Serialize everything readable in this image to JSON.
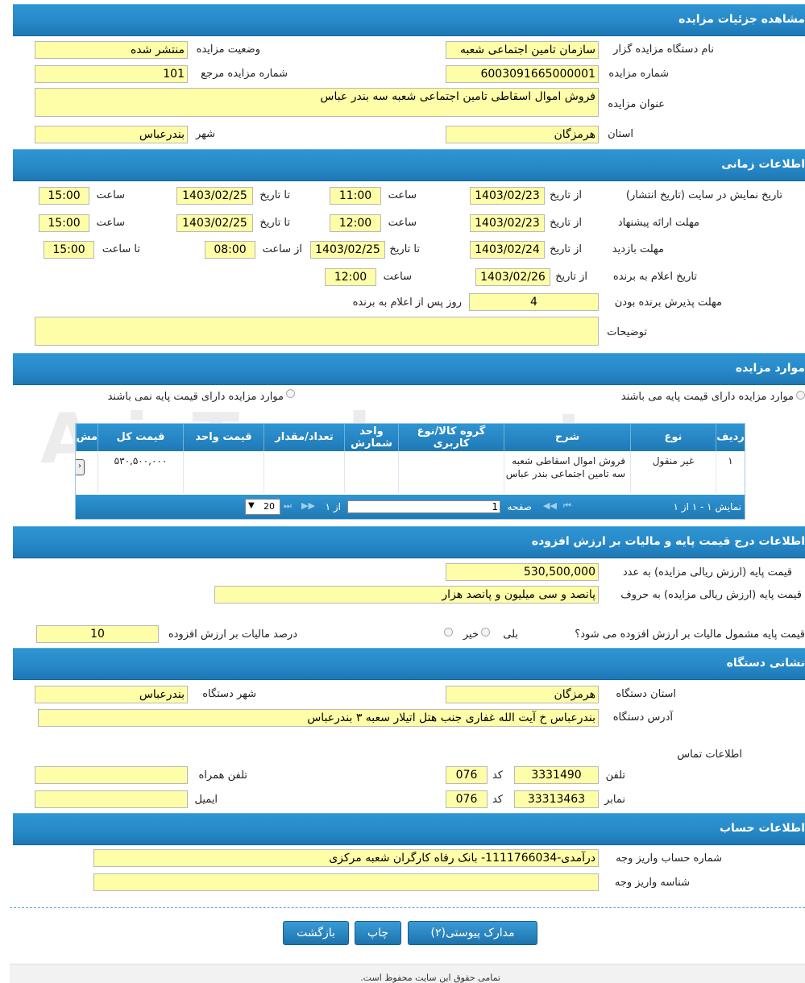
{
  "sections": {
    "details": "مشاهده جزئیات مزایده",
    "timing": "اطلاعات زمانی",
    "items": "موارد مزایده",
    "price": "اطلاعات درج قیمت پایه و مالیات بر ارزش افزوده",
    "address": "نشانی دستگاه",
    "account": "اطلاعات حساب"
  },
  "details": {
    "org_label": "نام دستگاه مزایده گزار",
    "org_value": "سازمان تامین اجتماعی شعبه",
    "status_label": "وضعیت مزایده",
    "status_value": "منتشر شده",
    "number_label": "شماره مزایده",
    "number_value": "6003091665000001",
    "ref_label": "شماره مزایده مرجع",
    "ref_value": "101",
    "title_label": "عنوان مزایده",
    "title_value": "فروش اموال اسقاطی تامین اجتماعی شعبه سه بندر عباس",
    "province_label": "استان",
    "province_value": "هرمزگان",
    "city_label": "شهر",
    "city_value": "بندرعباس"
  },
  "timing": {
    "from_date": "از تاریخ",
    "to_date": "تا تاریخ",
    "hour": "ساعت",
    "to_hour": "تا ساعت",
    "from_hour": "از ساعت",
    "display_label": "تاریخ نمایش در سایت (تاریخ انتشار)",
    "display_from": "1403/02/23",
    "display_from_time": "11:00",
    "display_to": "1403/02/25",
    "display_to_time": "15:00",
    "offer_label": "مهلت ارائه پیشنهاد",
    "offer_from": "1403/02/23",
    "offer_from_time": "12:00",
    "offer_to": "1403/02/25",
    "offer_to_time": "15:00",
    "visit_label": "مهلت بازدید",
    "visit_from": "1403/02/24",
    "visit_to": "1403/02/25",
    "visit_from_time": "08:00",
    "visit_to_time": "15:00",
    "winner_label": "تاریخ اعلام به برنده",
    "winner_from": "1403/02/26",
    "winner_time": "12:00",
    "accept_label": "مهلت پذیرش برنده بودن",
    "accept_value": "4",
    "accept_suffix": "روز پس از اعلام به برنده",
    "notes_label": "توضیحات",
    "notes_value": ""
  },
  "items": {
    "radio_with_price": "موارد مزایده دارای قیمت پایه می باشند",
    "radio_without_price": "موارد مزایده دارای قیمت پایه نمی باشند",
    "columns": [
      "ردیف",
      "نوع",
      "شرح",
      "گروه کالا/نوع کاربری",
      "واحد شمارش",
      "تعداد/مقدار",
      "قیمت واحد",
      "قیمت کل",
      "مش"
    ],
    "rows": [
      {
        "row": "۱",
        "type": "غیر منقول",
        "desc": "فروش اموال اسقاطی شعبه سه تامین اجتماعی بندر عباس",
        "group": "",
        "unit": "",
        "qty": "",
        "unit_price": "",
        "total": "۵۳۰,۵۰۰,۰۰۰"
      }
    ],
    "footer": {
      "showing": "نمایش ۱ - ۱ از ۱",
      "page_label": "صفحه",
      "page_value": "1",
      "of_label": "از ۱",
      "page_size": "20"
    }
  },
  "price": {
    "base_num_label": "قیمت پایه (ارزش ریالی مزایده) به عدد",
    "base_num_value": "530,500,000",
    "base_text_label": "قیمت پایه (ارزش ریالی مزایده) به حروف",
    "base_text_value": "پانصد و سی میلیون و پانصد هزار",
    "vat_q_label": "قیمت پایه مشمول مالیات بر ارزش افزوده می شود؟",
    "yes": "بلی",
    "no": "خیر",
    "vat_pct_label": "درصد مالیات بر ارزش افزوده",
    "vat_pct_value": "10"
  },
  "address": {
    "province_label": "استان دستگاه",
    "province_value": "هرمزگان",
    "city_label": "شهر دستگاه",
    "city_value": "بندرعباس",
    "addr_label": "آدرس دستگاه",
    "addr_value": "بندرعباس خ آیت الله غفاری جنب هتل اتیلار سعبه ۳ بندرعباس",
    "contact_label": "اطلاعات تماس",
    "phone_label": "تلفن",
    "phone_value": "3331490",
    "code_label": "کد",
    "phone_code": "076",
    "mobile_label": "تلفن همراه",
    "mobile_value": "",
    "fax_label": "نمابر",
    "fax_value": "33313463",
    "fax_code": "076",
    "email_label": "ایمیل",
    "email_value": ""
  },
  "account": {
    "acc_label": "شماره حساب واریز وجه",
    "acc_value": "درآمدی-1111766034- بانک رفاه کارگران شعبه مرکزی",
    "id_label": "شناسه واریز وجه",
    "id_value": ""
  },
  "buttons": {
    "attachments": "مدارک پیوستی(۲)",
    "print": "چاپ",
    "back": "بازگشت"
  },
  "footer_text": "تمامی حقوق این سایت محفوظ است.",
  "watermark": "AriaTender.net"
}
